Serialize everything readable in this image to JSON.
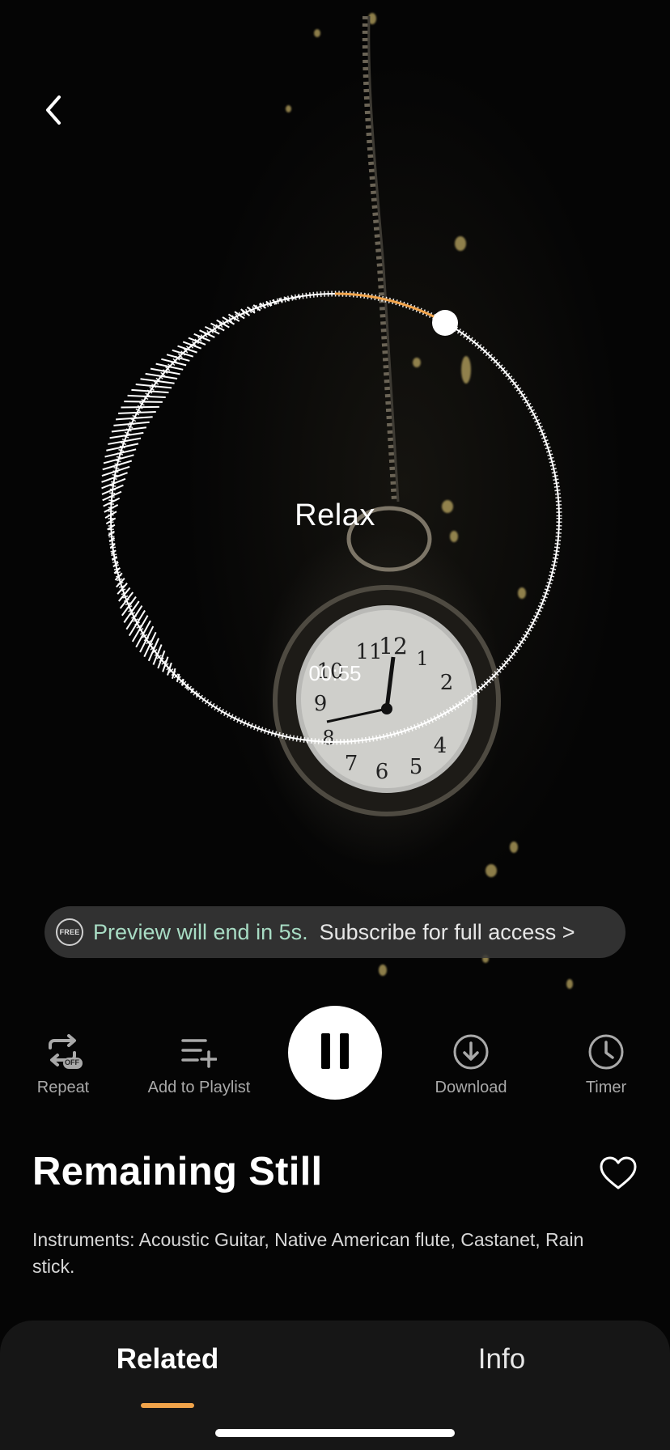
{
  "player": {
    "mood_title": "Relax",
    "elapsed_time": "00:55",
    "progress_fraction": 0.09
  },
  "preview_banner": {
    "badge": "FREE",
    "preview_text": "Preview will end in 5s.",
    "subscribe_text": "Subscribe for full access >"
  },
  "controls": {
    "repeat_label": "Repeat",
    "repeat_badge": "OFF",
    "add_to_playlist_label": "Add to Playlist",
    "download_label": "Download",
    "timer_label": "Timer"
  },
  "track": {
    "title": "Remaining Still",
    "description": "Instruments: Acoustic Guitar, Native American flute, Castanet, Rain stick."
  },
  "tabs": {
    "related": "Related",
    "info": "Info"
  },
  "icons": {
    "back": "chevron-left-icon",
    "repeat": "repeat-icon",
    "playlist": "add-to-playlist-icon",
    "pause": "pause-icon",
    "download": "download-icon",
    "timer": "clock-icon",
    "favorite": "heart-icon"
  },
  "colors": {
    "accent": "#f0a34a",
    "preview_text": "#a8dcc4",
    "background": "#000000",
    "sheet": "#161616"
  }
}
